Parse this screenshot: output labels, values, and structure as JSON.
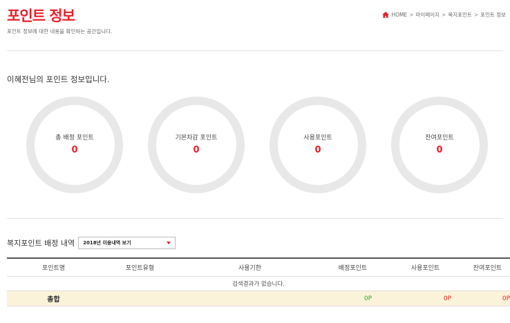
{
  "header": {
    "title": "포인트 정보",
    "description": "포인트 정보에 대한 내용을 확인하는 공간입니다.",
    "breadcrumb": [
      "HOME",
      "마이페이지",
      "복지포인트",
      "포인트 정보"
    ],
    "breadcrumb_separator": ">"
  },
  "owner_line": "이혜전님의 포인트 정보입니다.",
  "summary": [
    {
      "label": "총 배정 포인트",
      "value": "0"
    },
    {
      "label": "기본차감 포인트",
      "value": "0"
    },
    {
      "label": "사용포인트",
      "value": "0"
    },
    {
      "label": "잔여포인트",
      "value": "0"
    }
  ],
  "history": {
    "title": "복지포인트 배정 내역",
    "year_select": "2018년 이용내역 보기",
    "columns": [
      "포인트명",
      "포인트유형",
      "사용기한",
      "배정포인트",
      "사용포인트",
      "잔여포인트"
    ],
    "empty_message": "검색결과가 없습니다.",
    "total": {
      "label": "총합",
      "allocated": "0P",
      "used": "0P",
      "remaining": "0P"
    }
  },
  "colors": {
    "accent": "#e8202a",
    "green": "#2ca52c",
    "sum_row_bg": "#fbf3d9",
    "circle_ring": "#e8e8e8"
  }
}
